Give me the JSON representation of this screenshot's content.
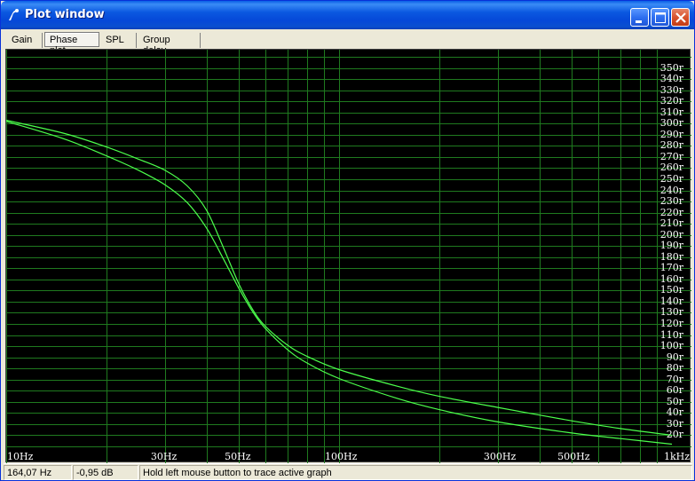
{
  "window": {
    "title": "Plot window",
    "title_color": "#0b58e0"
  },
  "tabs": [
    {
      "label": "Gain",
      "active": false
    },
    {
      "label": "Phase plot",
      "active": true
    },
    {
      "label": "SPL",
      "active": false
    },
    {
      "label": "Group delay",
      "active": false
    }
  ],
  "plot": {
    "background": "#000000",
    "grid_color": "#1f7a1f",
    "trace_color": "#4cff4c"
  },
  "chart_data": {
    "type": "line",
    "xscale": "log",
    "xlim": [
      10,
      1000
    ],
    "ylim": [
      10,
      360
    ],
    "x_tick_labels": [
      {
        "value": 10,
        "label": "10Hz"
      },
      {
        "value": 30,
        "label": "30Hz"
      },
      {
        "value": 50,
        "label": "50Hz"
      },
      {
        "value": 100,
        "label": "100Hz"
      },
      {
        "value": 300,
        "label": "300Hz"
      },
      {
        "value": 500,
        "label": "500Hz"
      },
      {
        "value": 1000,
        "label": "1kHz"
      }
    ],
    "y_tick_labels": [
      {
        "value": 350,
        "label": "350r"
      },
      {
        "value": 340,
        "label": "340r"
      },
      {
        "value": 330,
        "label": "330r"
      },
      {
        "value": 320,
        "label": "320r"
      },
      {
        "value": 310,
        "label": "310r"
      },
      {
        "value": 300,
        "label": "300r"
      },
      {
        "value": 290,
        "label": "290r"
      },
      {
        "value": 280,
        "label": "280r"
      },
      {
        "value": 270,
        "label": "270r"
      },
      {
        "value": 260,
        "label": "260r"
      },
      {
        "value": 250,
        "label": "250r"
      },
      {
        "value": 240,
        "label": "240r"
      },
      {
        "value": 230,
        "label": "230r"
      },
      {
        "value": 220,
        "label": "220r"
      },
      {
        "value": 210,
        "label": "210r"
      },
      {
        "value": 200,
        "label": "200r"
      },
      {
        "value": 190,
        "label": "190r"
      },
      {
        "value": 180,
        "label": "180r"
      },
      {
        "value": 170,
        "label": "170r"
      },
      {
        "value": 160,
        "label": "160r"
      },
      {
        "value": 150,
        "label": "150r"
      },
      {
        "value": 140,
        "label": "140r"
      },
      {
        "value": 130,
        "label": "130r"
      },
      {
        "value": 120,
        "label": "120r"
      },
      {
        "value": 110,
        "label": "110r"
      },
      {
        "value": 100,
        "label": "100r"
      },
      {
        "value": 90,
        "label": "90r"
      },
      {
        "value": 80,
        "label": "80r"
      },
      {
        "value": 70,
        "label": "70r"
      },
      {
        "value": 60,
        "label": "60r"
      },
      {
        "value": 50,
        "label": "50r"
      },
      {
        "value": 40,
        "label": "40r"
      },
      {
        "value": 30,
        "label": "30r"
      },
      {
        "value": 20,
        "label": "20r"
      }
    ],
    "series": [
      {
        "x": [
          10,
          15,
          20,
          25,
          30,
          35,
          40,
          45,
          50,
          55,
          60,
          70,
          80,
          100,
          150,
          200,
          300,
          500,
          700,
          1000
        ],
        "y": [
          302,
          286,
          271,
          258,
          245,
          229,
          206,
          178,
          152,
          131,
          116,
          97,
          85,
          71,
          53,
          43,
          32,
          22,
          17,
          12
        ]
      },
      {
        "x": [
          10,
          15,
          20,
          25,
          30,
          35,
          40,
          45,
          50,
          55,
          60,
          70,
          80,
          100,
          150,
          200,
          300,
          500,
          700,
          1000
        ],
        "y": [
          303,
          291,
          279,
          268,
          258,
          244,
          222,
          188,
          156,
          133,
          118,
          101,
          91,
          79,
          64,
          55,
          45,
          33,
          26,
          20
        ]
      }
    ]
  },
  "statusbar": {
    "frequency": "164,07 Hz",
    "level": "-0,95 dB",
    "hint": "Hold left mouse button to trace active graph"
  }
}
